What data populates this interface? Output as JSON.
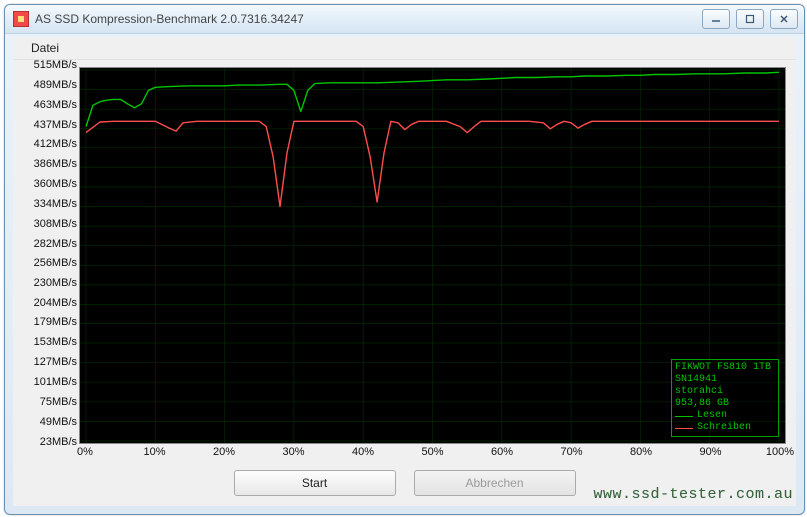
{
  "window": {
    "title": "AS SSD Kompression-Benchmark 2.0.7316.34247"
  },
  "menu": {
    "file": "Datei"
  },
  "device": {
    "line1": "FIKWOT FS810 1TB",
    "line2": "SN14941",
    "line3": "storahci",
    "line4": "953,86 GB"
  },
  "legend": {
    "read": "Lesen",
    "write": "Schreiben"
  },
  "buttons": {
    "start": "Start",
    "cancel": "Abbrechen"
  },
  "watermark": "www.ssd-tester.com.au",
  "chart_data": {
    "type": "line",
    "xlabel": "",
    "ylabel": "MB/s",
    "xlim": [
      0,
      100
    ],
    "ylim": [
      23,
      515
    ],
    "x_ticks": [
      0,
      10,
      20,
      30,
      40,
      50,
      60,
      70,
      80,
      90,
      100
    ],
    "x_tick_labels": [
      "0%",
      "10%",
      "20%",
      "30%",
      "40%",
      "50%",
      "60%",
      "70%",
      "80%",
      "90%",
      "100%"
    ],
    "y_ticks": [
      23,
      49,
      75,
      101,
      127,
      153,
      179,
      204,
      230,
      256,
      282,
      308,
      334,
      360,
      386,
      412,
      437,
      463,
      489,
      515
    ],
    "y_tick_labels": [
      "23MB/s",
      "49MB/s",
      "75MB/s",
      "101MB/s",
      "127MB/s",
      "153MB/s",
      "179MB/s",
      "204MB/s",
      "230MB/s",
      "256MB/s",
      "282MB/s",
      "308MB/s",
      "334MB/s",
      "360MB/s",
      "386MB/s",
      "412MB/s",
      "437MB/s",
      "463MB/s",
      "489MB/s",
      "515MB/s"
    ],
    "series": [
      {
        "name": "Lesen",
        "color": "#00c400",
        "points": [
          [
            0,
            440
          ],
          [
            1,
            468
          ],
          [
            2,
            473
          ],
          [
            3,
            475
          ],
          [
            4,
            476
          ],
          [
            5,
            476
          ],
          [
            6,
            470
          ],
          [
            7,
            465
          ],
          [
            8,
            470
          ],
          [
            9,
            488
          ],
          [
            10,
            492
          ],
          [
            12,
            493
          ],
          [
            15,
            494
          ],
          [
            18,
            494
          ],
          [
            20,
            494
          ],
          [
            22,
            495
          ],
          [
            25,
            495
          ],
          [
            28,
            496
          ],
          [
            29,
            496
          ],
          [
            30,
            488
          ],
          [
            31,
            460
          ],
          [
            32,
            488
          ],
          [
            33,
            497
          ],
          [
            35,
            498
          ],
          [
            38,
            498
          ],
          [
            40,
            498
          ],
          [
            42,
            498
          ],
          [
            45,
            499
          ],
          [
            48,
            500
          ],
          [
            50,
            501
          ],
          [
            52,
            502
          ],
          [
            55,
            502
          ],
          [
            58,
            503
          ],
          [
            60,
            504
          ],
          [
            62,
            505
          ],
          [
            65,
            505
          ],
          [
            68,
            506
          ],
          [
            70,
            506
          ],
          [
            72,
            507
          ],
          [
            75,
            507
          ],
          [
            78,
            508
          ],
          [
            80,
            508
          ],
          [
            82,
            509
          ],
          [
            85,
            509
          ],
          [
            88,
            510
          ],
          [
            90,
            510
          ],
          [
            92,
            510
          ],
          [
            95,
            511
          ],
          [
            98,
            511
          ],
          [
            100,
            512
          ]
        ]
      },
      {
        "name": "Schreiben",
        "color": "#ff4d4d",
        "points": [
          [
            0,
            432
          ],
          [
            2,
            446
          ],
          [
            4,
            447
          ],
          [
            6,
            447
          ],
          [
            8,
            447
          ],
          [
            10,
            447
          ],
          [
            12,
            438
          ],
          [
            13,
            434
          ],
          [
            14,
            445
          ],
          [
            16,
            447
          ],
          [
            18,
            447
          ],
          [
            20,
            447
          ],
          [
            22,
            447
          ],
          [
            24,
            447
          ],
          [
            25,
            447
          ],
          [
            26,
            440
          ],
          [
            27,
            400
          ],
          [
            28,
            334
          ],
          [
            29,
            405
          ],
          [
            30,
            447
          ],
          [
            32,
            447
          ],
          [
            34,
            447
          ],
          [
            36,
            447
          ],
          [
            38,
            447
          ],
          [
            39,
            447
          ],
          [
            40,
            440
          ],
          [
            41,
            400
          ],
          [
            42,
            340
          ],
          [
            43,
            405
          ],
          [
            44,
            447
          ],
          [
            45,
            445
          ],
          [
            46,
            436
          ],
          [
            47,
            443
          ],
          [
            48,
            447
          ],
          [
            50,
            447
          ],
          [
            52,
            447
          ],
          [
            54,
            440
          ],
          [
            55,
            432
          ],
          [
            56,
            440
          ],
          [
            57,
            447
          ],
          [
            58,
            447
          ],
          [
            60,
            447
          ],
          [
            62,
            447
          ],
          [
            64,
            447
          ],
          [
            66,
            445
          ],
          [
            67,
            437
          ],
          [
            68,
            443
          ],
          [
            69,
            447
          ],
          [
            70,
            445
          ],
          [
            71,
            438
          ],
          [
            72,
            443
          ],
          [
            73,
            447
          ],
          [
            75,
            447
          ],
          [
            78,
            447
          ],
          [
            80,
            447
          ],
          [
            82,
            447
          ],
          [
            85,
            447
          ],
          [
            88,
            447
          ],
          [
            90,
            447
          ],
          [
            92,
            447
          ],
          [
            95,
            447
          ],
          [
            98,
            447
          ],
          [
            100,
            447
          ]
        ]
      }
    ]
  }
}
